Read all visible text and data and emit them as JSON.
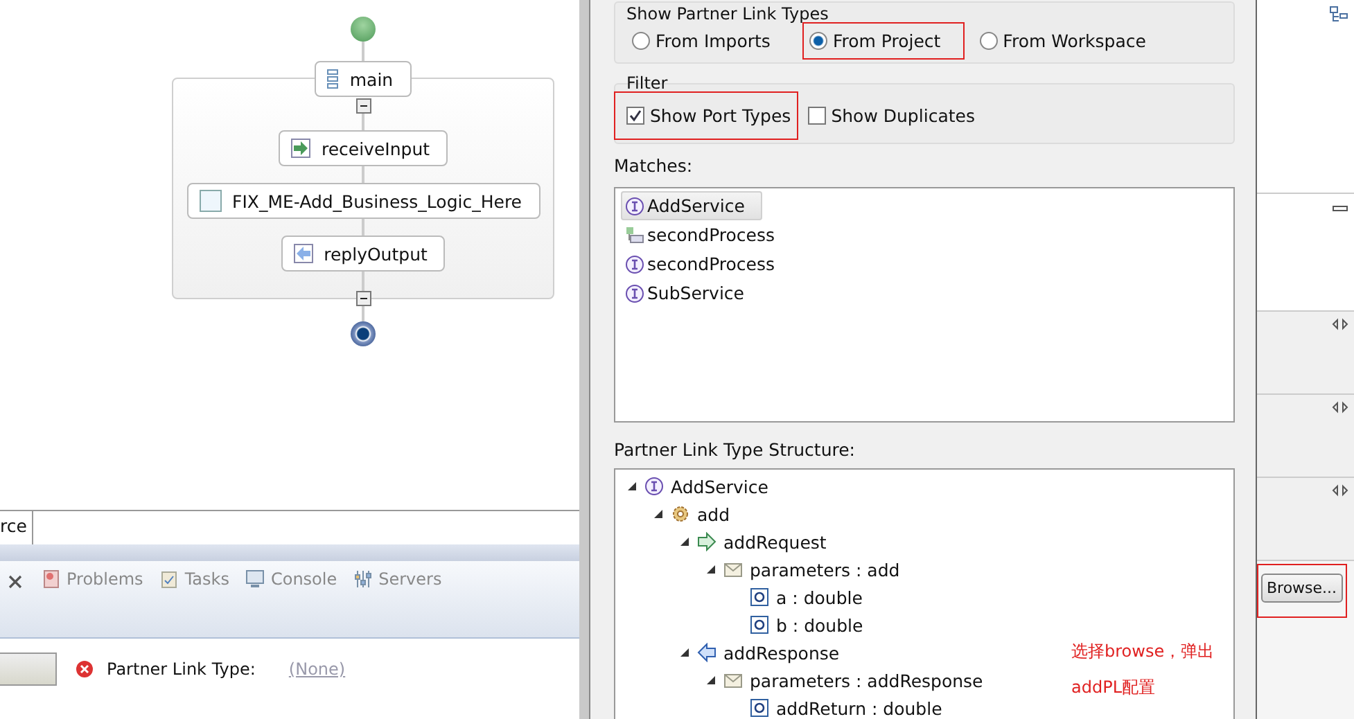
{
  "diagram": {
    "start": {
      "kind": "start"
    },
    "scope": {
      "label": "main",
      "collapsed": false,
      "activities": [
        {
          "kind": "receive",
          "label": "receiveInput"
        },
        {
          "kind": "empty",
          "label": "FIX_ME-Add_Business_Logic_Here"
        },
        {
          "kind": "reply",
          "label": "replyOutput"
        }
      ]
    },
    "end": {
      "kind": "end"
    }
  },
  "editor_tabs": [
    {
      "label": "rce",
      "selected": true
    }
  ],
  "views": {
    "tabs": [
      {
        "kind": "problems",
        "label": "Problems"
      },
      {
        "kind": "tasks",
        "label": "Tasks"
      },
      {
        "kind": "console",
        "label": "Console"
      },
      {
        "kind": "servers",
        "label": "Servers"
      }
    ]
  },
  "properties": {
    "label": "Partner Link Type:",
    "error": true,
    "value": "(None)"
  },
  "dialog": {
    "source_group": {
      "title": "Show Partner Link Types",
      "options": [
        {
          "label": "From Imports",
          "selected": false,
          "highlighted": false
        },
        {
          "label": "From Project",
          "selected": true,
          "highlighted": true
        },
        {
          "label": "From Workspace",
          "selected": false,
          "highlighted": false
        }
      ]
    },
    "filter": {
      "title": "Filter",
      "options": [
        {
          "label": "Show Port Types",
          "checked": true,
          "highlighted": true
        },
        {
          "label": "Show Duplicates",
          "checked": false,
          "highlighted": false
        }
      ]
    },
    "matches_label": "Matches:",
    "matches": [
      {
        "kind": "interface",
        "label": "AddService",
        "selected": true
      },
      {
        "kind": "process",
        "label": "secondProcess",
        "selected": false
      },
      {
        "kind": "interface",
        "label": "secondProcess",
        "selected": false
      },
      {
        "kind": "interface",
        "label": "SubService",
        "selected": false
      }
    ],
    "structure_label": "Partner Link Type Structure:",
    "structure": [
      {
        "kind": "interface",
        "label": "AddService",
        "expanded": true,
        "children": [
          {
            "kind": "operation",
            "label": "add",
            "expanded": true,
            "children": [
              {
                "kind": "input",
                "label": "addRequest",
                "expanded": true,
                "children": [
                  {
                    "kind": "message",
                    "label": "parameters : add",
                    "expanded": true,
                    "children": [
                      {
                        "kind": "element",
                        "label": "a : double"
                      },
                      {
                        "kind": "element",
                        "label": "b : double"
                      }
                    ]
                  }
                ]
              },
              {
                "kind": "output",
                "label": "addResponse",
                "expanded": true,
                "children": [
                  {
                    "kind": "message",
                    "label": "parameters : addResponse",
                    "expanded": true,
                    "children": [
                      {
                        "kind": "element",
                        "label": "addReturn : double"
                      }
                    ]
                  }
                ]
              }
            ]
          }
        ]
      }
    ]
  },
  "annotation": {
    "lines": [
      "选择browse，弹出",
      "addPL配置"
    ]
  },
  "browse_button": {
    "label": "Browse...",
    "highlighted": true
  }
}
